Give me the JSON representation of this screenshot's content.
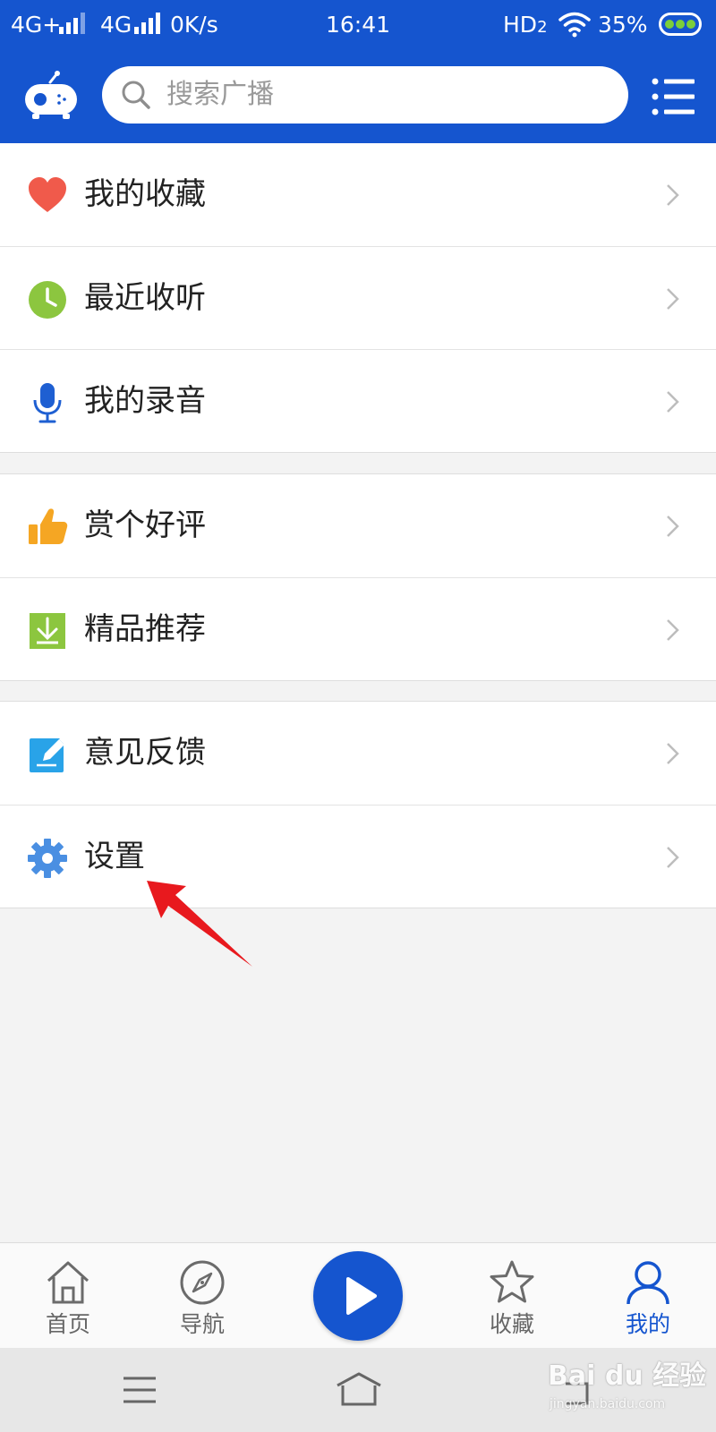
{
  "status_bar": {
    "network1": "4G+",
    "network2": "4G",
    "speed": "0K/s",
    "time": "16:41",
    "hd": "HD",
    "hd_sub": "2",
    "battery": "35%"
  },
  "header": {
    "search_placeholder": "搜索广播",
    "icons": [
      "radio-logo-icon",
      "search-icon",
      "list-menu-icon"
    ]
  },
  "menu": {
    "group1": [
      {
        "label": "我的收藏",
        "icon": "heart-icon",
        "color": "#f05a4b"
      },
      {
        "label": "最近收听",
        "icon": "clock-icon",
        "color": "#8cc63f"
      },
      {
        "label": "我的录音",
        "icon": "microphone-icon",
        "color": "#1e5fd2"
      }
    ],
    "group2": [
      {
        "label": "赏个好评",
        "icon": "thumbs-up-icon",
        "color": "#f5a623"
      },
      {
        "label": "精品推荐",
        "icon": "download-icon",
        "color": "#8cc63f"
      }
    ],
    "group3": [
      {
        "label": "意见反馈",
        "icon": "feedback-edit-icon",
        "color": "#29a3e8"
      },
      {
        "label": "设置",
        "icon": "gear-icon",
        "color": "#4a8fe2"
      }
    ]
  },
  "tabbar": {
    "home": "首页",
    "nav": "导航",
    "favorites": "收藏",
    "mine": "我的",
    "active": "我的"
  },
  "watermark": {
    "main": "Bai du 经验",
    "sub": "jingyan.baidu.com"
  },
  "colors": {
    "brand": "#1555cf",
    "annotation": "#e8191e",
    "background": "#f3f3f3"
  }
}
